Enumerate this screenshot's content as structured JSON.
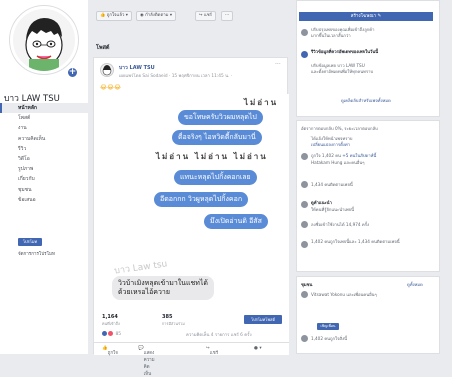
{
  "sidebar": {
    "page_name": "บาว LAW TSU",
    "items": [
      "หน้าหลัก",
      "โพสต์",
      "งาน",
      "ความคิดเห็น",
      "รีวิว",
      "วิดีโอ",
      "รูปภาพ",
      "เกี่ยวกับ",
      "ชุมชน",
      "ข้อเสนอ"
    ],
    "promote": "โปรโมท",
    "manage_promotions": "จัดการการโปรโมท"
  },
  "topbar": {
    "like_button": "ถูกใจแล้ว ▾",
    "follow_button": "กำลังติดตาม ▾",
    "share_button": "แชร์",
    "more_button": "···"
  },
  "section_title": "โพสต์",
  "post": {
    "author": "บาว LAW TSU",
    "meta": "เผยแพร่โดย Sai Sodaeid · 15 พฤศจิกายน เวลา 11:45 น. ·",
    "emoji": "😂😂😂",
    "chat": {
      "sticker1": "ไม่อ่าน",
      "bubble1": "ขอโทษครับวิวผมหลุดไป",
      "bubble2": "ตื่อจริงๆ ไอหวิดตี้กลับมานี่",
      "sticker2": "ไม่อ่าน ไม่อ่าน ไม่อ่าน",
      "bubble3": "แทนะหลุดไปกิ้งคอกเลย",
      "bubble4": "อีดอกกก วิวผูหลุดไปกิ้งคอก",
      "bubble5": "มึงเปิดอ่านดิ อีสัส",
      "watermark": "บาว Law tsu",
      "reply": "วิวบ้าเมิงหลุดเข้ามาในแชทได้\nด้วยเหรอไอ้ควาย"
    },
    "stats": {
      "reach_value": "1,164",
      "reach_label": "คนที่เข้าถึง",
      "engage_value": "385",
      "engage_label": "การมีส่วนร่วม",
      "boost_button": "โปรโมทโพสต์",
      "reactions": "85",
      "comments_shares": "ความคิดเห็น 4 รายการ แชร์ 6 ครั้ง"
    },
    "actions": [
      "ถูกใจ",
      "แสดงความคิดเห็น",
      "แชร์",
      "● ▾"
    ]
  },
  "right": {
    "create_ad": "สร้างโฆษณา ✎",
    "tip1": "ปรับปรุงเพจของคุณเพื่อเข้าถึงลูกค้า\nมากขึ้นในเวลาสั้นกว่า",
    "tip2_title": "รีวิวข้อมูลที่ควรอัพเดทของเพจในวันนี้",
    "tip2_body": "ปรับข้อมูลเพจ บาว LAW TSU\nและตั้งค่าอัพเดทเพื่อให้ทุกคนทราบ",
    "see_all": "ดูเคล็ดลับสำหรับเพจทั้งหมด",
    "insight1": "อัตราการตอบกลับ 0%, ระยะเวลาตอบกลับ",
    "insight1b": "ได้แจ้งให้หน้าเพจทราบ",
    "insight1c": "เปลี่ยนแปลงการตั้งค่า",
    "likes_line": "ถูกใจ 1,402 คน",
    "likes_new": "+5 คนในสัปดาห์นี้",
    "likes_friend": "Hatakam Hung และคนอื่นๆ",
    "followers": "1,434 คนติดตามเพจนี้",
    "recommend_title": "ดูคำแนะนำ",
    "recommend_body": "ให้คนที่รู้จักแนะนำเพจนี้",
    "checkins": "ลงชื่อเข้าใช้งานได้ 14,974 ครั้ง",
    "people_like": "1,402 คนถูกใจเพจนี้และ 1,434 คนติดตามเพจนี้",
    "community_title": "ชุมชน",
    "community_link": "ดูทั้งหมด",
    "invite": "เชิญเพื่อน",
    "community_line1": "Vitsawat Yokonu และเพื่อนคนอื่นๆ",
    "community_line2": "1,402 คนถูกใจสิ่งนี้"
  }
}
